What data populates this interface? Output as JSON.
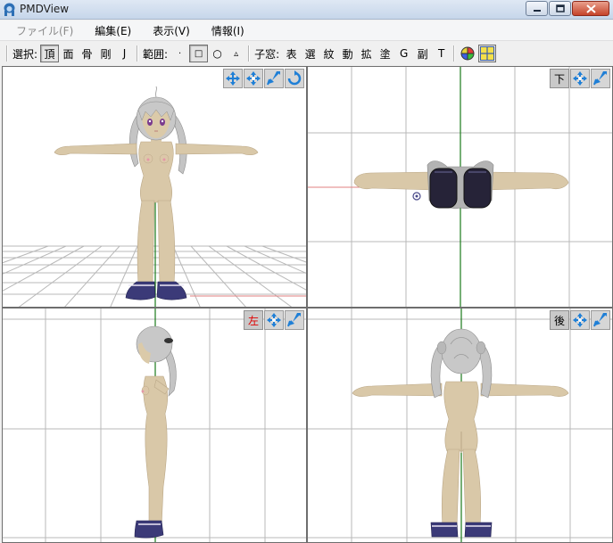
{
  "window": {
    "title": "PMDView",
    "icon": "pmdview-app-icon"
  },
  "menu": [
    {
      "label": "ファイル(F)",
      "disabled": true
    },
    {
      "label": "編集(E)",
      "disabled": false
    },
    {
      "label": "表示(V)",
      "disabled": false
    },
    {
      "label": "情報(I)",
      "disabled": false
    }
  ],
  "toolbar": {
    "select_label": "選択:",
    "select_modes": [
      "頂",
      "面",
      "骨",
      "剛",
      "J"
    ],
    "select_active": "頂",
    "range_label": "範囲:",
    "range_modes": [
      "·",
      "□",
      "○",
      "▵"
    ],
    "range_active": "□",
    "child_label": "子窓:",
    "child_windows": [
      "表",
      "選",
      "紋",
      "動",
      "拡",
      "塗",
      "G",
      "副",
      "T"
    ],
    "icons": [
      "color-wheel-icon",
      "four-view-icon"
    ]
  },
  "views": {
    "front": {
      "tools": [
        "move-icon",
        "pan-icon",
        "zoom-icon",
        "rotate-icon"
      ]
    },
    "bottom": {
      "label": "下",
      "tools": [
        "pan-icon",
        "zoom-icon"
      ]
    },
    "left": {
      "label": "左",
      "tools": [
        "pan-icon",
        "zoom-icon"
      ]
    },
    "back": {
      "label": "後",
      "tools": [
        "pan-icon",
        "zoom-icon"
      ]
    }
  },
  "colors": {
    "skin": "#d9c8a8",
    "skin_shade": "#bba888",
    "hair": "#c8c8c8",
    "hair_shade": "#8e8e8e",
    "shoe": "#3b3a78",
    "axis_green": "#1a7a1a",
    "axis_red": "#e08080",
    "grid": "#b8b8b8",
    "tool_blue": "#1f7fd6"
  }
}
